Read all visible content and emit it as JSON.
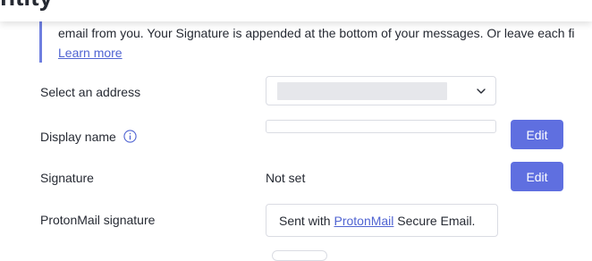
{
  "header": {
    "clipped_title": "ntity"
  },
  "info_note": {
    "text": "email from you. Your Signature is appended at the bottom of your messages. Or leave each fi",
    "link_label": "Learn more"
  },
  "rows": {
    "address": {
      "label": "Select an address",
      "selected_value": ""
    },
    "display_name": {
      "label": "Display name",
      "value": "",
      "edit_label": "Edit"
    },
    "signature": {
      "label": "Signature",
      "value": "Not set",
      "edit_label": "Edit"
    },
    "protonmail_signature": {
      "label": "ProtonMail signature",
      "prefix": "Sent with ",
      "link": "ProtonMail",
      "suffix": " Secure Email."
    }
  },
  "colors": {
    "accent": "#5f6fe0",
    "link": "#5064d2",
    "note_border": "#6f7fe0",
    "text": "#262a33",
    "border": "#dadce3"
  },
  "icons": {
    "info": "info-circle-icon",
    "chevron": "chevron-down-icon"
  }
}
